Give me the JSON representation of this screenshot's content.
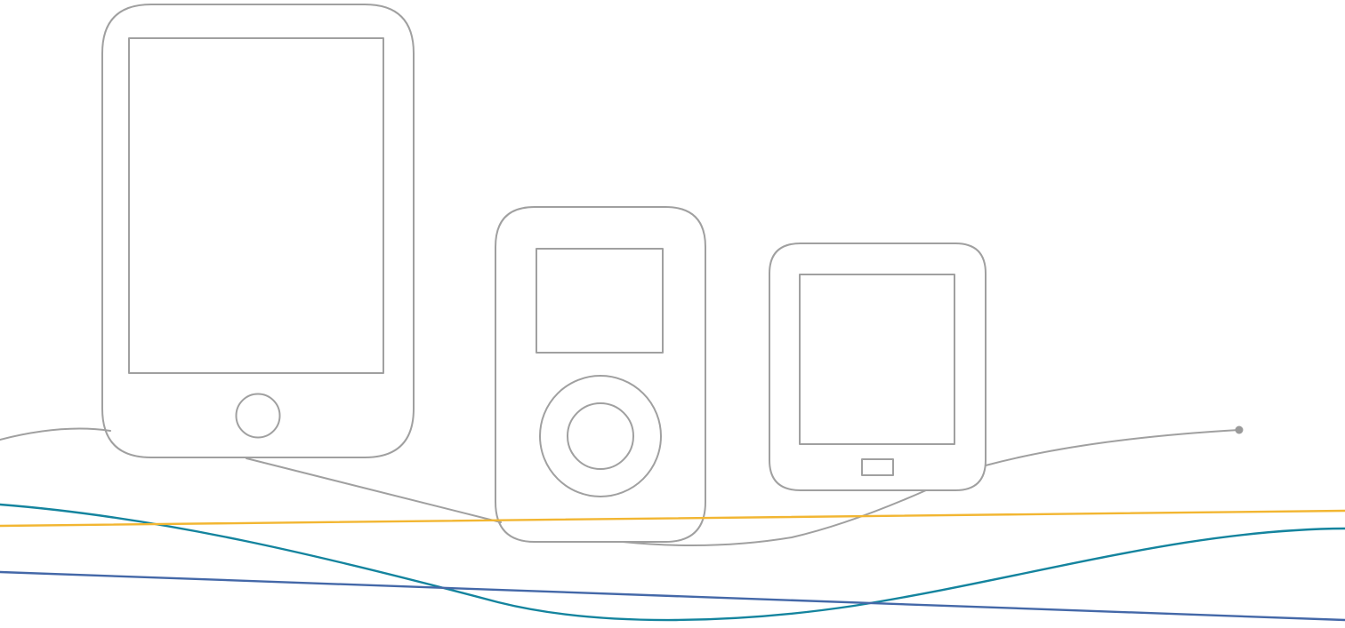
{
  "colors": {
    "background": "#ffffff",
    "device_outline": "#a0a0a0",
    "connector_dot": "#9a9a9a",
    "wave_yellow": "#f2b632",
    "wave_teal": "#14849e",
    "wave_blue": "#4468a8"
  },
  "devices": [
    "tablet",
    "media-player",
    "e-reader"
  ]
}
